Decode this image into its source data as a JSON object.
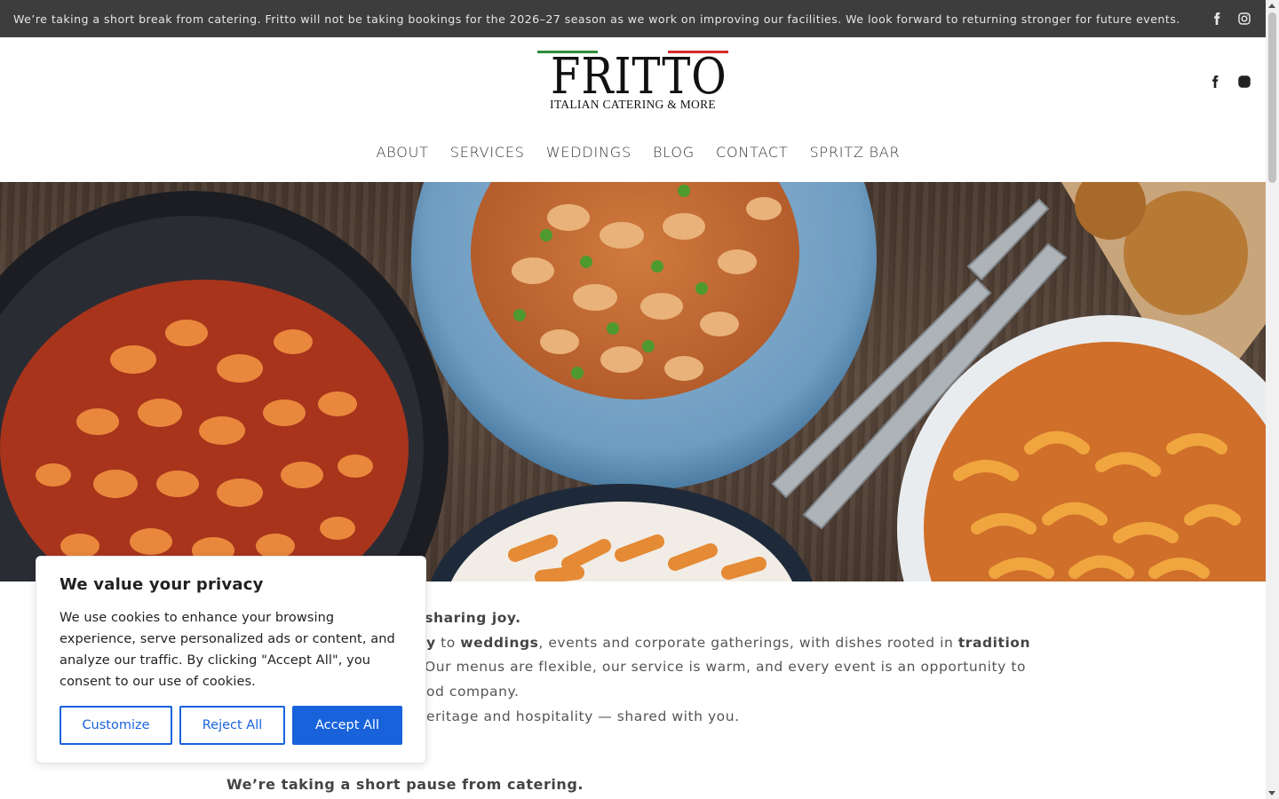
{
  "announcement": {
    "text": "We’re taking a short break from catering. Fritto will not be taking bookings for the 2026–27 season as we work on improving our facilities. We look forward to returning stronger for future events."
  },
  "brand": {
    "name": "FRITTO",
    "tagline": "ITALIAN CATERING & MORE",
    "colors": {
      "green": "#2e8b3a",
      "red": "#d42a2a"
    }
  },
  "nav": {
    "items": [
      "ABOUT",
      "SERVICES",
      "WEDDINGS",
      "BLOG",
      "CONTACT",
      "SPRITZ BAR"
    ]
  },
  "social": {
    "icons": [
      "facebook-icon",
      "instagram-icon"
    ]
  },
  "content": {
    "line1_bold": "f sharing joy.",
    "line2_a": "y",
    "line2_b": " to ",
    "line2_c": "weddings",
    "line2_d": ", events and corporate gatherings, with dishes rooted in ",
    "line2_e": "tradition",
    "line3": "Our menus are flexible, our service is warm, and every event is an opportunity to",
    "line4": "od company.",
    "line5": "eritage and hospitality — shared with you.",
    "pause": "We’re taking a short pause from catering."
  },
  "cookie": {
    "title": "We value your privacy",
    "description": "We use cookies to enhance your browsing experience, serve personalized ads or content, and analyze our traffic. By clicking \"Accept All\", you consent to our use of cookies.",
    "customize_label": "Customize",
    "reject_label": "Reject All",
    "accept_label": "Accept All",
    "accent": "#1863dc"
  }
}
